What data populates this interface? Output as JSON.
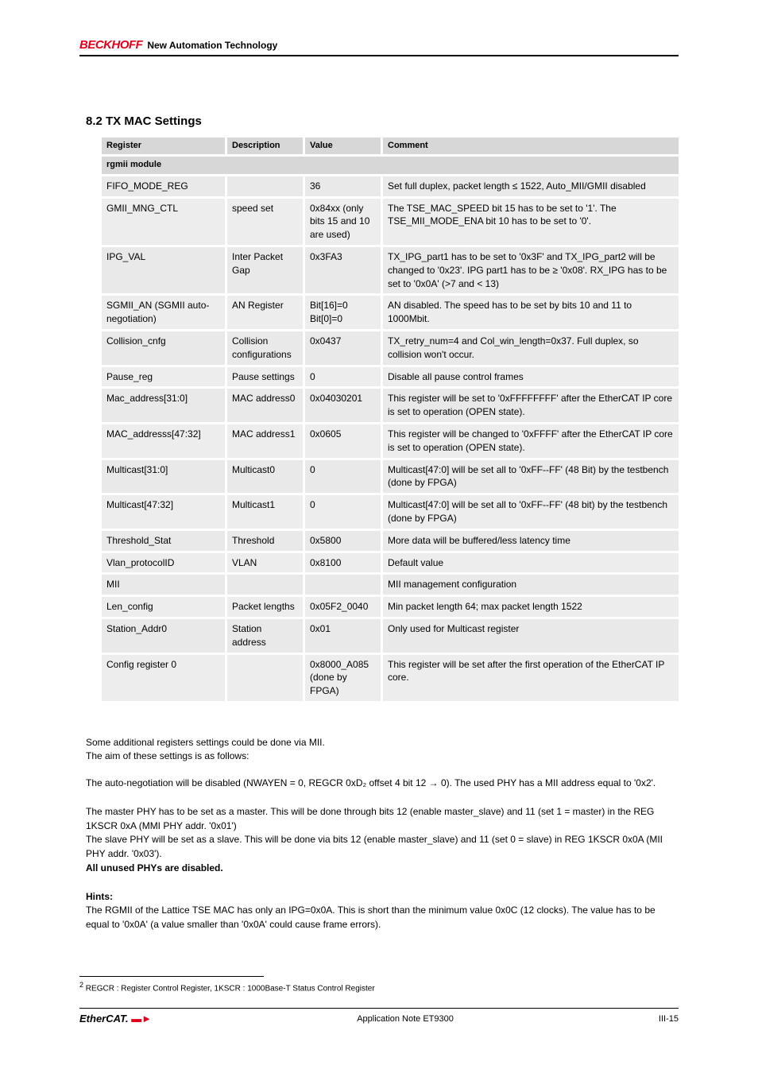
{
  "header": {
    "logo": "BECKHOFF",
    "tagline": "New Automation Technology"
  },
  "section_title": "8.2 TX MAC Settings",
  "table": {
    "headers": {
      "register": "Register",
      "description": "Description",
      "value": "Value",
      "comment": "Comment"
    },
    "module": "rgmii module",
    "rows": [
      {
        "register": "FIFO_MODE_REG",
        "description": "",
        "value": "36",
        "comment": "Set full duplex, packet length ≤ 1522, Auto_MII/GMII disabled"
      },
      {
        "register": "GMII_MNG_CTL",
        "description": "speed set",
        "value": "0x84xx (only bits 15 and 10 are used)",
        "comment": "The TSE_MAC_SPEED bit 15 has to be set to '1'. The TSE_MII_MODE_ENA bit 10 has to be set to '0'."
      },
      {
        "register": "IPG_VAL",
        "description": "Inter Packet Gap",
        "value": "0x3FA3",
        "comment": "TX_IPG_part1 has to be set to '0x3F' and TX_IPG_part2 will be changed to '0x23'. IPG part1 has to be ≥ '0x08'. RX_IPG has to be set to '0x0A' (>7 and < 13)"
      },
      {
        "register": "SGMII_AN (SGMII auto-negotiation)",
        "description": "AN Register",
        "value": "Bit[16]=0 Bit[0]=0",
        "comment": "AN disabled. The speed has to be set by bits 10 and 11 to 1000Mbit."
      },
      {
        "register": "Collision_cnfg",
        "description": "Collision configurations",
        "value": "0x0437",
        "comment": "TX_retry_num=4 and Col_win_length=0x37. Full duplex, so collision won't occur."
      },
      {
        "register": "Pause_reg",
        "description": "Pause settings",
        "value": "0",
        "comment": "Disable all pause control frames"
      },
      {
        "register": "Mac_address[31:0]",
        "description": "MAC address0",
        "value": "0x04030201",
        "comment": "This register will be set to '0xFFFFFFFF' after the EtherCAT IP core is set to operation (OPEN state)."
      },
      {
        "register": "MAC_addresss[47:32]",
        "description": "MAC address1",
        "value": "0x0605",
        "comment": "This register will be changed to '0xFFFF' after the EtherCAT IP core is set to operation (OPEN state)."
      },
      {
        "register": "Multicast[31:0]",
        "description": "Multicast0",
        "value": "0",
        "comment": "Multicast[47:0] will be set all to '0xFF--FF' (48 Bit) by the testbench (done by FPGA)"
      },
      {
        "register": "Multicast[47:32]",
        "description": "Multicast1",
        "value": "0",
        "comment": "Multicast[47:0] will be set all to '0xFF--FF' (48 bit) by the testbench (done by FPGA)"
      },
      {
        "register": "Threshold_Stat",
        "description": "Threshold",
        "value": "0x5800",
        "comment": "More data will be buffered/less latency time"
      },
      {
        "register": "Vlan_protocolID",
        "description": "VLAN",
        "value": "0x8100",
        "comment": "Default value"
      },
      {
        "register": "MII",
        "description": "",
        "value": "",
        "comment": "MII management configuration"
      },
      {
        "register": "Len_config",
        "description": "Packet lengths",
        "value": "0x05F2_0040",
        "comment": "Min packet length 64; max packet length 1522"
      },
      {
        "register": "Station_Addr0",
        "description": "Station address",
        "value": "0x01",
        "comment": "Only used for Multicast register"
      },
      {
        "register": "Config register 0",
        "description": "",
        "value": "0x8000_A085 (done by FPGA)",
        "comment": "This register will be set after the first operation of the EtherCAT IP core."
      }
    ]
  },
  "intro1": "Some additional registers settings could be done via MII.",
  "intro1a": "The aim of these settings is as follows:",
  "intro2": "The auto-negotiation will be disabled (NWAYEN = 0, REGCR 0xD₂ offset 4 bit 12 → 0). The used PHY has a MII address equal to '0x2'.",
  "intro3": "The master PHY has to be set as a master. This will be done through bits 12 (enable master_slave) and 11 (set 1 = master) in the REG 1KSCR 0xA (MMI PHY addr. '0x01')",
  "intro4": "The slave PHY will be set as a slave. This will be done via bits 12 (enable master_slave) and 11 (set 0 = slave) in REG 1KSCR 0x0A (MII PHY addr. '0x03').",
  "intro5": "All unused PHYs are disabled.",
  "hint_title": "Hints:",
  "hint_text": "The RGMII of the Lattice TSE MAC has only an IPG=0x0A. This is short than the minimum value 0x0C (12 clocks). The value has to be equal to '0x0A' (a value smaller than '0x0A' could cause frame errors).",
  "footnote": "2 REGCR : Register Control Register, 1KSCR : 1000Base-T Status Control Register",
  "footer": {
    "ethercat": "EtherCAT.",
    "appnote": "Application Note ET9300",
    "page": "III-15"
  }
}
